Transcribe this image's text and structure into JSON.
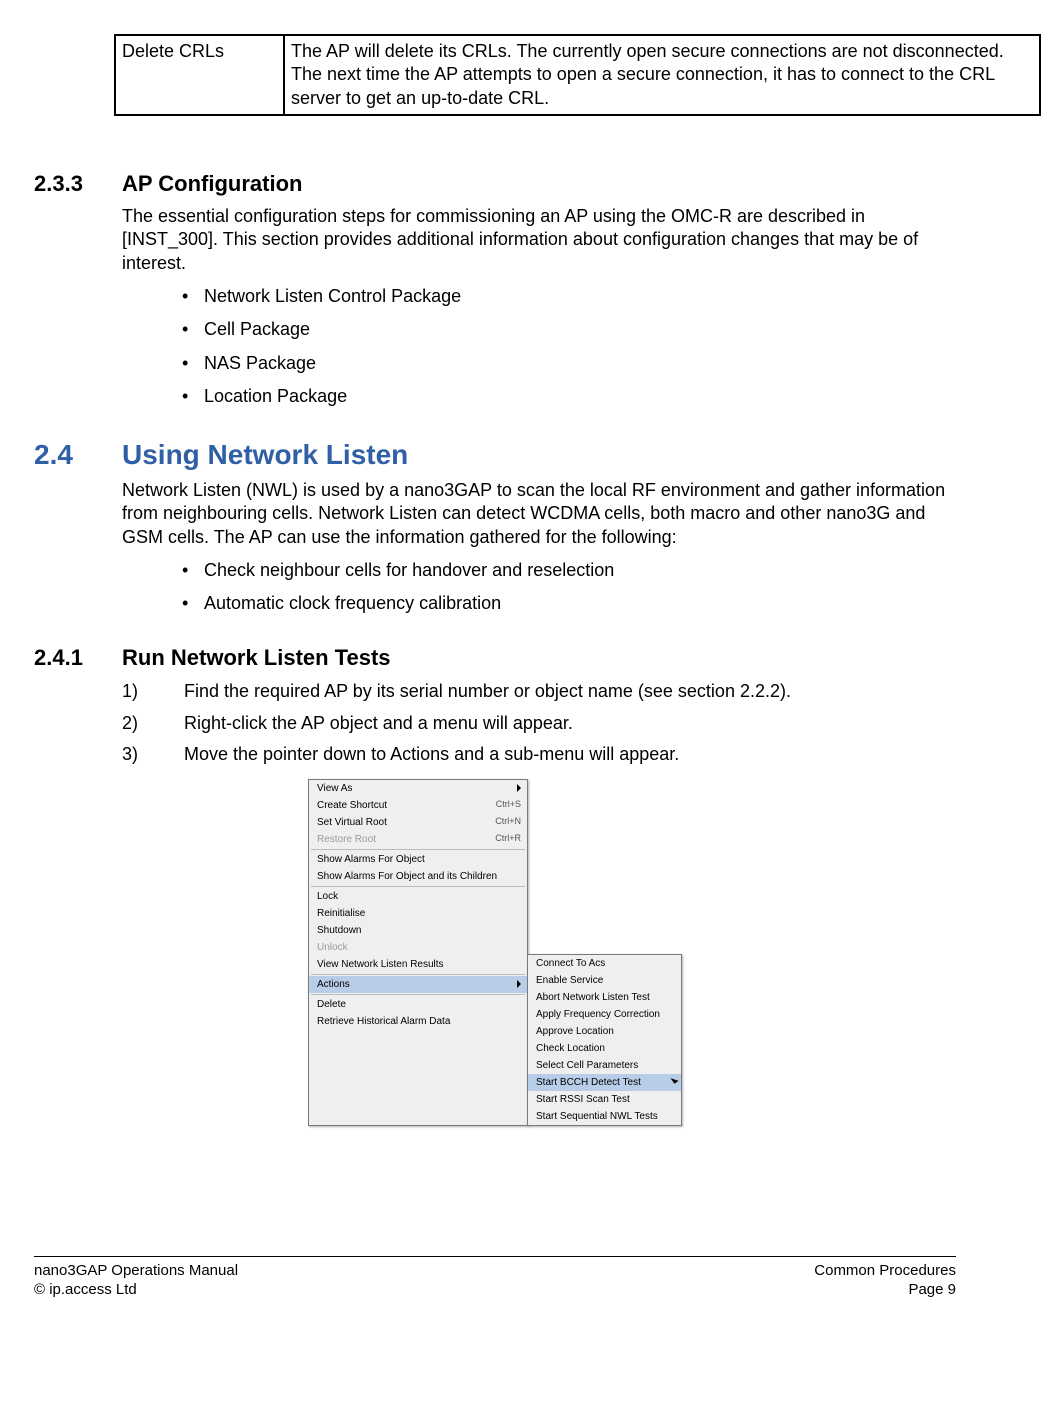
{
  "table": {
    "col1": "Delete CRLs",
    "col2": "The AP will delete its CRLs. The currently open secure connections are not disconnected. The next time the AP attempts to open a secure connection, it has to connect to the CRL server to get an up-to-date CRL."
  },
  "s233": {
    "num": "2.3.3",
    "title": "AP Configuration",
    "body": "The essential configuration steps for commissioning an AP using the OMC-R are described in [INST_300]. This section provides additional information about configuration changes that may be of interest.",
    "bullets": [
      "Network Listen Control Package",
      "Cell Package",
      "NAS Package",
      "Location Package"
    ]
  },
  "s24": {
    "num": "2.4",
    "title": "Using Network Listen",
    "body": "Network Listen (NWL) is used by a nano3GAP to scan the local RF environment and gather information from neighbouring cells. Network Listen can detect WCDMA cells, both macro and other nano3G and GSM cells. The AP can use the information gathered for the following:",
    "bullets": [
      "Check neighbour cells for handover and reselection",
      "Automatic clock frequency calibration"
    ]
  },
  "s241": {
    "num": "2.4.1",
    "title": "Run Network Listen Tests",
    "steps": [
      "Find the required AP by its serial number or object name (see section 2.2.2).",
      "Right-click the AP object and a menu will appear.",
      "Move the pointer down to Actions and a sub-menu will appear."
    ],
    "stepnums": [
      "1)",
      "2)",
      "3)"
    ]
  },
  "menu": {
    "items": [
      {
        "label": "View As",
        "arrow": true,
        "sep": false
      },
      {
        "label": "Create Shortcut",
        "shortcut": "Ctrl+S"
      },
      {
        "label": "Set Virtual Root",
        "shortcut": "Ctrl+N"
      },
      {
        "label": "Restore Root",
        "shortcut": "Ctrl+R",
        "disabled": true,
        "sepAfter": true
      },
      {
        "label": "Show Alarms For Object"
      },
      {
        "label": "Show Alarms For Object and its Children",
        "sepAfter": true
      },
      {
        "label": "Lock"
      },
      {
        "label": "Reinitialise"
      },
      {
        "label": "Shutdown"
      },
      {
        "label": "Unlock",
        "disabled": true
      },
      {
        "label": "View Network Listen Results",
        "sepAfter": true
      },
      {
        "label": "Actions",
        "arrow": true,
        "selected": true,
        "sepAfter": true
      },
      {
        "label": "Delete"
      },
      {
        "label": "Retrieve Historical Alarm Data"
      }
    ],
    "sub": [
      {
        "label": "Connect To Acs"
      },
      {
        "label": "Enable Service"
      },
      {
        "label": "Abort Network Listen Test"
      },
      {
        "label": "Apply Frequency Correction"
      },
      {
        "label": "Approve Location"
      },
      {
        "label": "Check Location"
      },
      {
        "label": "Select Cell Parameters"
      },
      {
        "label": "Start BCCH Detect Test",
        "selected": true,
        "cursor": true
      },
      {
        "label": "Start RSSI Scan Test"
      },
      {
        "label": "Start Sequential NWL Tests"
      }
    ]
  },
  "footer": {
    "l1": "nano3GAP Operations Manual",
    "l2": "© ip.access Ltd",
    "r1": "Common Procedures",
    "r2": "Page 9"
  }
}
